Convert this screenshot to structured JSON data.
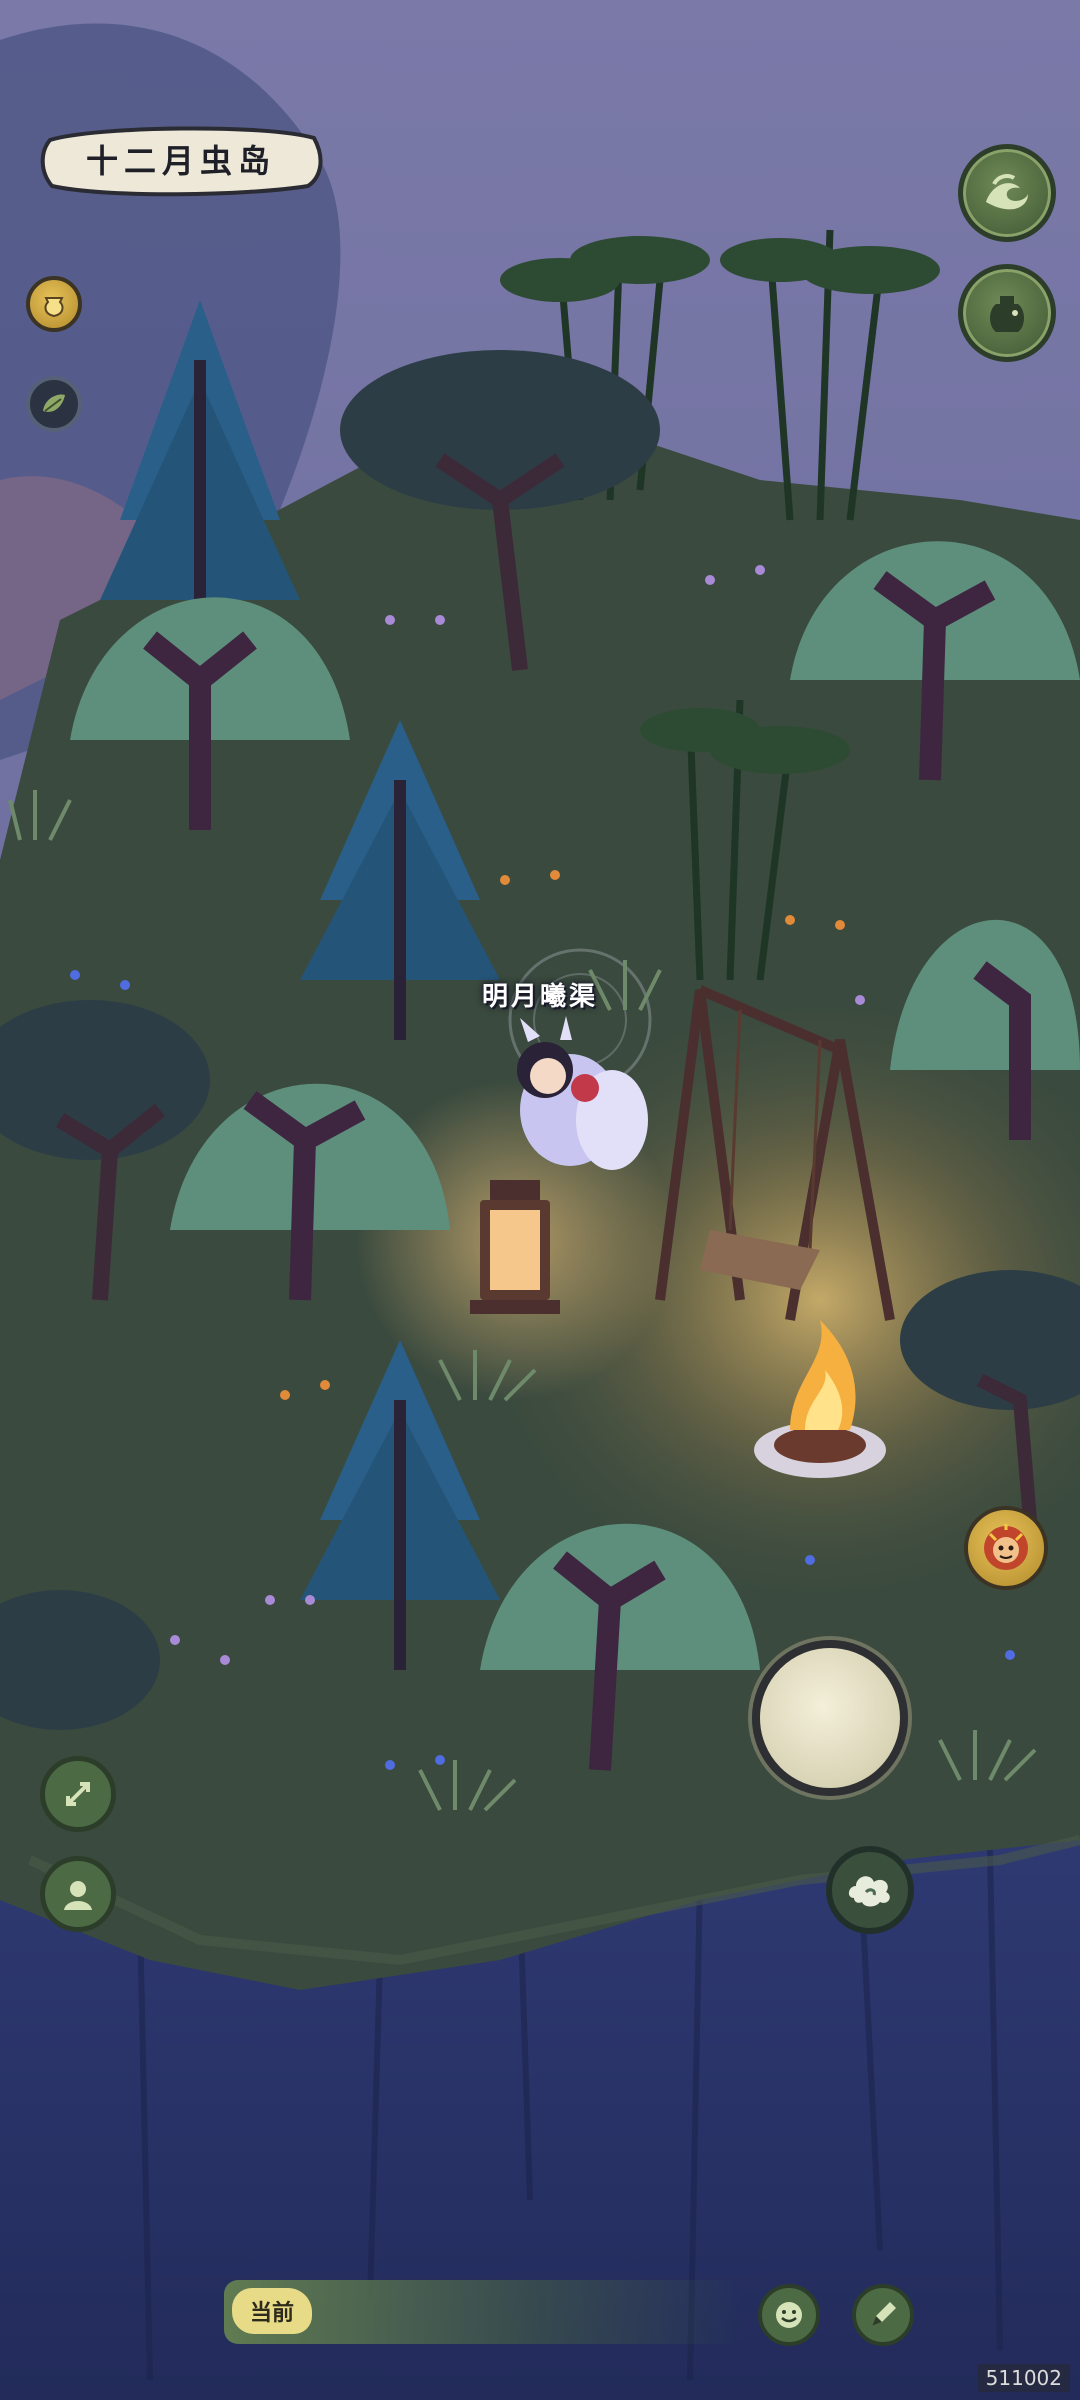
{
  "location": {
    "title": "十二月虫岛"
  },
  "player": {
    "name": "明月曦渠"
  },
  "chat": {
    "channel_label": "当前"
  },
  "version": {
    "text": "511002"
  },
  "hud": {
    "left_buttons": [
      "treasure-pot-icon",
      "leaf-icon"
    ],
    "right_buttons": [
      "wave-icon",
      "jar-icon"
    ],
    "bottom_left": [
      "expand-arrows-icon",
      "character-icon"
    ],
    "action": [
      "monkey-skill-icon",
      "cloud-icon"
    ],
    "chat_buttons": [
      "emoji-icon",
      "write-icon"
    ]
  },
  "colors": {
    "sky": "#6d6f9c",
    "grass": "#3a4a3e",
    "cliff": "#2b3569",
    "willow": "#5e8f7c",
    "pine": "#2a5f8a",
    "campfire": "#f5b040"
  }
}
